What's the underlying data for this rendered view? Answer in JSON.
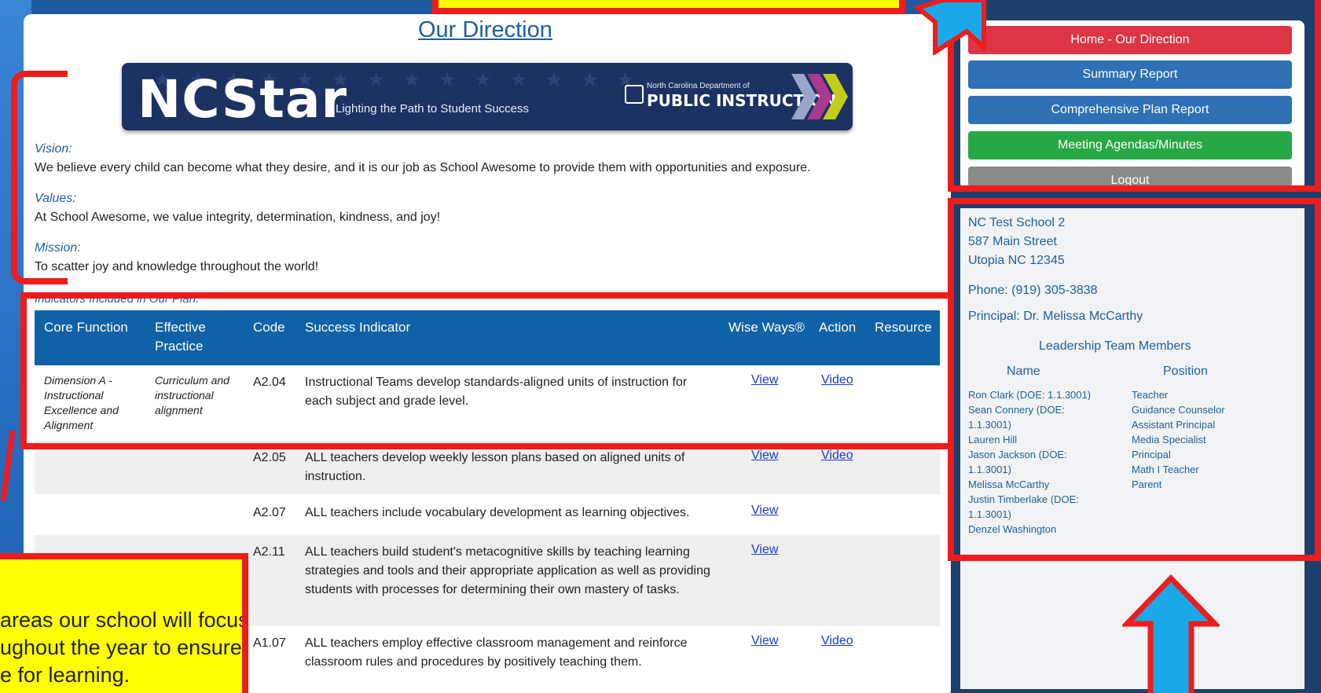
{
  "page": {
    "title": "Our Direction"
  },
  "banner": {
    "logo": "NCStar",
    "tagline": "Lighting the Path to Student Success",
    "dept_small": "North Carolina Department of",
    "dept": "PUBLIC INSTRUCTION"
  },
  "vision": {
    "label": "Vision:",
    "text": "We believe every child can become what they desire, and it is our job as School Awesome to provide them with opportunities and exposure."
  },
  "values": {
    "label": "Values:",
    "text": "At School Awesome, we value integrity, determination, kindness, and joy!"
  },
  "mission": {
    "label": "Mission:",
    "text": "To scatter joy and knowledge throughout the world!"
  },
  "indicators_caption": "Indicators Included in Our Plan:",
  "table": {
    "headers": {
      "core_function": "Core Function",
      "effective_practice": "Effective Practice",
      "code": "Code",
      "success_indicator": "Success Indicator",
      "wise_ways": "Wise Ways®",
      "action": "Action",
      "resource": "Resource"
    },
    "rows": [
      {
        "core_function": "Dimension A - Instructional Excellence and Alignment",
        "effective_practice": "Curriculum and instructional alignment",
        "code": "A2.04",
        "indicator": "Instructional Teams develop standards-aligned units of instruction for each subject and grade level.",
        "wise_ways": "View",
        "action": "Video"
      },
      {
        "code": "A2.05",
        "indicator": "ALL teachers develop weekly lesson plans based on aligned units of instruction.",
        "wise_ways": "View",
        "action": "Video"
      },
      {
        "code": "A2.07",
        "indicator": "ALL teachers include vocabulary development as learning objectives.",
        "wise_ways": "View"
      },
      {
        "code": "A2.11",
        "indicator": "ALL teachers build student's metacognitive skills by teaching learning strategies and tools and their appropriate application as well as providing students with processes for determining their own mastery of tasks.",
        "wise_ways": "View"
      },
      {
        "code": "A1.07",
        "indicator": "ALL teachers employ effective classroom management and reinforce classroom rules and procedures by positively teaching them.",
        "wise_ways": "View",
        "action": "Video"
      }
    ]
  },
  "nav": {
    "home": "Home - Our Direction",
    "summary": "Summary Report",
    "comprehensive": "Comprehensive Plan Report",
    "meetings": "Meeting Agendas/Minutes",
    "logout": "Logout"
  },
  "school": {
    "name": "NC Test School 2",
    "street": "587 Main Street",
    "city": "Utopia NC 12345",
    "phone": "Phone: (919) 305-3838",
    "principal": "Principal: Dr. Melissa McCarthy"
  },
  "team": {
    "title": "Leadership Team Members",
    "name_header": "Name",
    "position_header": "Position",
    "names": [
      "Ron Clark (DOE: 1.1.3001)",
      "Sean Connery (DOE:",
      "1.1.3001)",
      "Lauren Hill",
      "Jason Jackson (DOE:",
      "1.1.3001)",
      "Melissa McCarthy",
      "Justin Timberlake (DOE:",
      "1.1.3001)",
      "Denzel Washington"
    ],
    "positions": [
      "Teacher",
      "Guidance Counselor",
      "Assistant Principal",
      "Media Specialist",
      "Principal",
      "Math I Teacher",
      "Parent"
    ]
  },
  "annotation": {
    "lines": [
      "areas our school will focus",
      "ughout the year to ensure",
      "e for learning."
    ]
  },
  "colors": {
    "nav_red": "#dc3545",
    "nav_blue": "#2f70b7",
    "nav_green": "#28a745",
    "nav_gray": "#8a8a8a",
    "table_header": "#0f62a7",
    "annotation_red": "#ee1c1c",
    "annotation_yellow": "#ffff00",
    "arrow_blue": "#1ba8e8"
  }
}
